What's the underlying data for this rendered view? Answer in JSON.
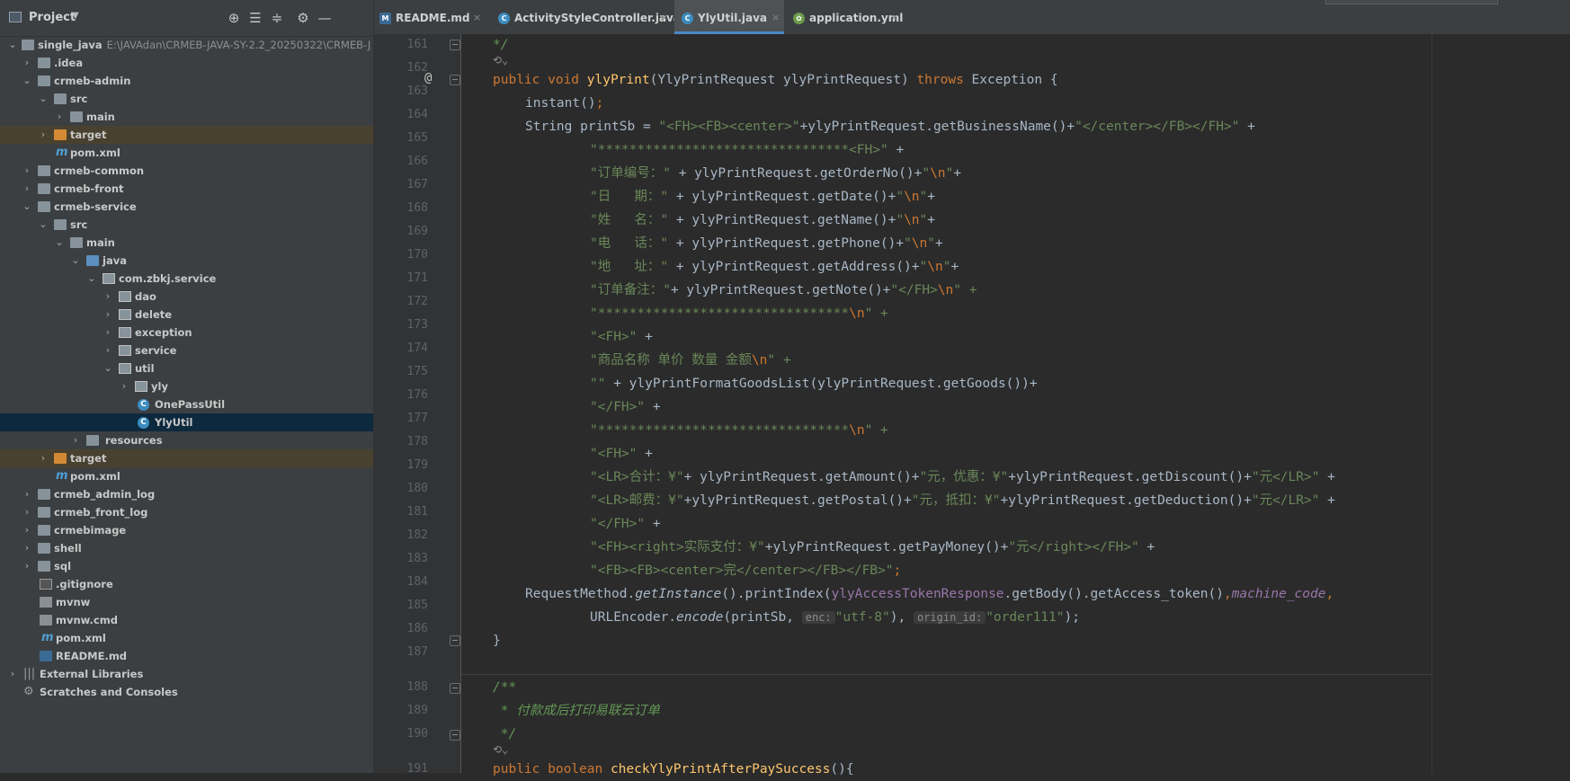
{
  "project_panel": {
    "title": "Project",
    "tree": [
      {
        "label": "single_java",
        "sublabel": "E:\\JAVAdan\\CRMEB-JAVA-SY-2.2_20250322\\CRMEB-J",
        "icon": "module-folder-icon"
      },
      {
        "label": ".idea",
        "icon": "folder-icon"
      },
      {
        "label": "crmeb-admin",
        "icon": "module-folder-icon"
      },
      {
        "label": "src",
        "icon": "folder-icon"
      },
      {
        "label": "main",
        "icon": "folder-icon"
      },
      {
        "label": "target",
        "icon": "excluded-folder-icon"
      },
      {
        "label": "pom.xml",
        "icon": "maven-icon"
      },
      {
        "label": "crmeb-common",
        "icon": "module-folder-icon"
      },
      {
        "label": "crmeb-front",
        "icon": "module-folder-icon"
      },
      {
        "label": "crmeb-service",
        "icon": "module-folder-icon"
      },
      {
        "label": "src",
        "icon": "folder-icon"
      },
      {
        "label": "main",
        "icon": "folder-icon"
      },
      {
        "label": "java",
        "icon": "source-folder-icon"
      },
      {
        "label": "com.zbkj.service",
        "icon": "package-icon"
      },
      {
        "label": "dao",
        "icon": "package-icon"
      },
      {
        "label": "delete",
        "icon": "package-icon"
      },
      {
        "label": "exception",
        "icon": "package-icon"
      },
      {
        "label": "service",
        "icon": "package-icon"
      },
      {
        "label": "util",
        "icon": "package-icon"
      },
      {
        "label": "yly",
        "icon": "package-icon"
      },
      {
        "label": "OnePassUtil",
        "icon": "java-class-icon"
      },
      {
        "label": "YlyUtil",
        "icon": "java-class-icon"
      },
      {
        "label": "resources",
        "icon": "resources-folder-icon"
      },
      {
        "label": "target",
        "icon": "excluded-folder-icon"
      },
      {
        "label": "pom.xml",
        "icon": "maven-icon"
      },
      {
        "label": "crmeb_admin_log",
        "icon": "folder-icon"
      },
      {
        "label": "crmeb_front_log",
        "icon": "folder-icon"
      },
      {
        "label": "crmebimage",
        "icon": "folder-icon"
      },
      {
        "label": "shell",
        "icon": "folder-icon"
      },
      {
        "label": "sql",
        "icon": "folder-icon"
      },
      {
        "label": ".gitignore",
        "icon": "gitignore-icon"
      },
      {
        "label": "mvnw",
        "icon": "file-icon"
      },
      {
        "label": "mvnw.cmd",
        "icon": "file-icon"
      },
      {
        "label": "pom.xml",
        "icon": "maven-icon"
      },
      {
        "label": "README.md",
        "icon": "markdown-icon"
      },
      {
        "label": "External Libraries",
        "icon": "libraries-icon"
      },
      {
        "label": "Scratches and Consoles",
        "icon": "scratches-icon"
      }
    ]
  },
  "tabs": [
    {
      "label": "README.md",
      "icon": "markdown-icon",
      "active": false
    },
    {
      "label": "ActivityStyleController.java",
      "icon": "java-class-icon",
      "active": false
    },
    {
      "label": "YlyUtil.java",
      "icon": "java-class-icon",
      "active": true
    },
    {
      "label": "application.yml",
      "icon": "yaml-icon",
      "active": false
    }
  ],
  "close_glyph": "×",
  "editor": {
    "line_numbers": [
      "161",
      "162",
      "163",
      "164",
      "165",
      "166",
      "167",
      "168",
      "169",
      "170",
      "171",
      "172",
      "173",
      "174",
      "175",
      "176",
      "177",
      "178",
      "179",
      "180",
      "181",
      "182",
      "183",
      "184",
      "185",
      "186",
      "187",
      "188",
      "189",
      "190",
      "191"
    ],
    "gutter_annotation": "@",
    "param_hint_enc": "enc:",
    "param_hint_origin_id": "origin_id:",
    "lines": {
      "l161": "*/",
      "l162_a": "public void ",
      "l162_fn": "ylyPrint",
      "l162_b": "(YlyPrintRequest ylyPrintRequest) ",
      "l162_kw": "throws",
      "l162_c": " Exception {",
      "l163_a": "instant()",
      "l163_b": ";",
      "l164_a": "String printSb = ",
      "l164_s1": "\"<FH><FB><center>\"",
      "l164_b": "+ylyPrintRequest.getBusinessName()+",
      "l164_s2": "\"</center></FB></FH>\"",
      "l164_c": " +",
      "l165_s": "\"********************************<FH>\"",
      "l165_c": " +",
      "l166_s": "\"订单编号：\"",
      "l166_b": " + ylyPrintRequest.getOrderNo()+",
      "l166_q1": "\"",
      "l166_esc": "\\n",
      "l166_q2": "\"",
      "l166_c": "+",
      "l167_s": "\"日   期：\"",
      "l167_b": " + ylyPrintRequest.getDate()+",
      "l168_s": "\"姓   名：\"",
      "l168_b": " + ylyPrintRequest.getName()+",
      "l169_s": "\"电   话：\"",
      "l169_b": " + ylyPrintRequest.getPhone()+",
      "l170_s": "\"地   址：\"",
      "l170_b": " + ylyPrintRequest.getAddress()+",
      "l171_s": "\"订单备注：\"",
      "l171_b": "+ ylyPrintRequest.getNote()+",
      "l171_s2": "\"</FH>",
      "l171_c": "\" +",
      "l172_s": "\"********************************",
      "l172_c": "\" +",
      "l173_s": "\"<FH>\"",
      "l173_c": " +",
      "l174_s": "\"商品名称 单价 数量 金额",
      "l174_c": "\" +",
      "l175_s": "\"\"",
      "l175_b": " + ylyPrintFormatGoodsList(ylyPrintRequest.getGoods())+",
      "l176_s": "\"</FH>\"",
      "l176_c": " +",
      "l177_s": "\"********************************",
      "l177_c": "\" +",
      "l178_s": "\"<FH>\"",
      "l178_c": " +",
      "l179_s1": "\"<LR>合计：¥\"",
      "l179_b": "+ ylyPrintRequest.getAmount()+",
      "l179_s2": "\"元，优惠：¥\"",
      "l179_d": "+ylyPrintRequest.getDiscount()+",
      "l179_s3": "\"元</LR>\"",
      "l179_c": " +",
      "l180_s1": "\"<LR>邮费：¥\"",
      "l180_b": "+ylyPrintRequest.getPostal()+",
      "l180_s2": "\"元，抵扣：¥\"",
      "l180_d": "+ylyPrintRequest.getDeduction()+",
      "l180_s3": "\"元</LR>\"",
      "l180_c": " +",
      "l181_s": "\"</FH>\"",
      "l181_c": " +",
      "l182_s1": "\"<FH><right>实际支付：¥\"",
      "l182_b": "+ylyPrintRequest.getPayMoney()+",
      "l182_s2": "\"元</right></FH>\"",
      "l182_c": " +",
      "l183_s": "\"<FB><FB><center>完</center></FB></FB>\"",
      "l183_c": ";",
      "l184_a": "RequestMethod.",
      "l184_i": "getInstance",
      "l184_b": "().printIndex(",
      "l184_f1": "ylyAccessTokenResponse",
      "l184_c": ".getBody().getAccess_token()",
      "l184_comma": ",",
      "l184_f2": "machine_code",
      "l184_comma2": ",",
      "l185_a": "URLEncoder.",
      "l185_i": "encode",
      "l185_b": "(printSb, ",
      "l185_s1": "\"utf-8\"",
      "l185_c": "), ",
      "l185_s2": "\"order111\"",
      "l185_d": ");",
      "l186": "}",
      "l188": "/**",
      "l189": " * 付款成后打印易联云订单",
      "l190": " */",
      "l191_a": "public boolean ",
      "l191_fn": "checkYlyPrintAfterPaySuccess",
      "l191_b": "(){"
    }
  },
  "colors": {
    "keyword": "#cc7832",
    "function": "#ffc66d",
    "string": "#6a8759",
    "comment": "#629755",
    "field": "#9876aa",
    "text": "#a9b7c6",
    "selection": "#0d293e",
    "excluded": "#49412f"
  }
}
